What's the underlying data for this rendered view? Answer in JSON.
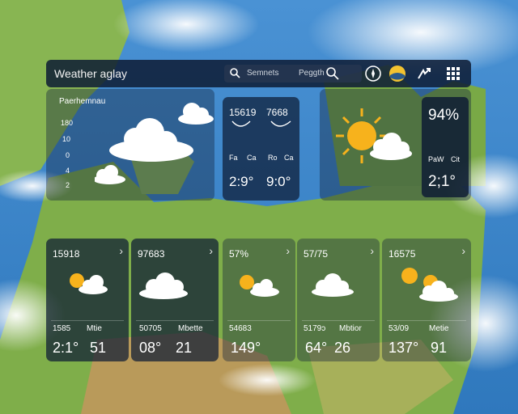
{
  "header": {
    "title": "Weather aglay",
    "search_text_1": "Semnets",
    "search_text_2": "Peggth"
  },
  "map_panel": {
    "title": "Paerhemnau",
    "scale": [
      "180",
      "10",
      "0",
      "4",
      "2"
    ]
  },
  "mini_card": {
    "value_left": "15619",
    "value_right": "7668",
    "label_1": "Fa",
    "label_2": "Ca",
    "label_3": "Ro",
    "label_4": "Ca",
    "temp_left": "2:9°",
    "temp_right": "9:0°"
  },
  "current_card": {
    "percent": "94%",
    "label_1": "PaW",
    "label_2": "Cit",
    "temp": "2;1°"
  },
  "forecast": [
    {
      "top": "15918",
      "sub_left": "1585",
      "sub_right": "Mtie",
      "temp": "2:1°",
      "extra": "51",
      "icon": "sun-cloud-icon"
    },
    {
      "top": "97683",
      "sub_left": "50705",
      "sub_right": "Mbette",
      "temp": "08°",
      "extra": "21",
      "icon": "cloud-icon"
    },
    {
      "top": "57%",
      "sub_left": "54683",
      "sub_right": "",
      "temp": "149°",
      "extra": "",
      "icon": "sun-cloud-icon"
    },
    {
      "top": "57/75",
      "sub_left": "5179ɔ",
      "sub_right": "Mbtior",
      "temp": "64°",
      "extra": "26",
      "icon": "cloud-icon"
    },
    {
      "top": "16575",
      "sub_left": "53/09",
      "sub_right": "Metie",
      "temp": "137°",
      "extra": "91",
      "icon": "sun-sun-cloud-icon"
    }
  ],
  "colors": {
    "panel": "#0e1c34",
    "sun": "#f7b21c",
    "sea": "#3f88c9",
    "land": "#7cae4c"
  }
}
